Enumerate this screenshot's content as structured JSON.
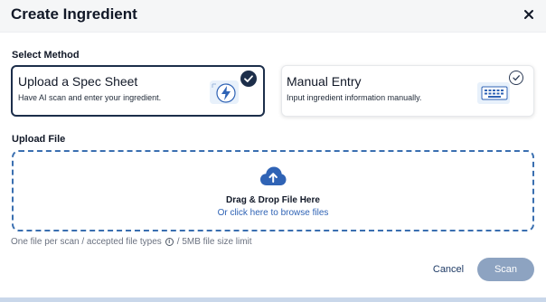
{
  "dialog": {
    "title": "Create Ingredient"
  },
  "method": {
    "label": "Select Method",
    "options": [
      {
        "title": "Upload a Spec Sheet",
        "description": "Have AI scan and enter your ingredient.",
        "selected": true,
        "icon": "lightning-scan-icon"
      },
      {
        "title": "Manual Entry",
        "description": "Input ingredient information manually.",
        "selected": false,
        "icon": "keyboard-icon"
      }
    ]
  },
  "upload": {
    "label": "Upload File",
    "drop_title": "Drag & Drop File Here",
    "browse_link": "Or click here to browse files",
    "icon": "cloud-upload-icon",
    "hint_prefix": "One file per scan / accepted file types",
    "hint_suffix": "/ 5MB file size limit"
  },
  "actions": {
    "cancel": "Cancel",
    "scan": "Scan"
  },
  "colors": {
    "primary": "#1c2e4a",
    "link": "#2f63b5",
    "scan_disabled": "#8da3c1",
    "dashed_border": "#3a6fb0"
  }
}
